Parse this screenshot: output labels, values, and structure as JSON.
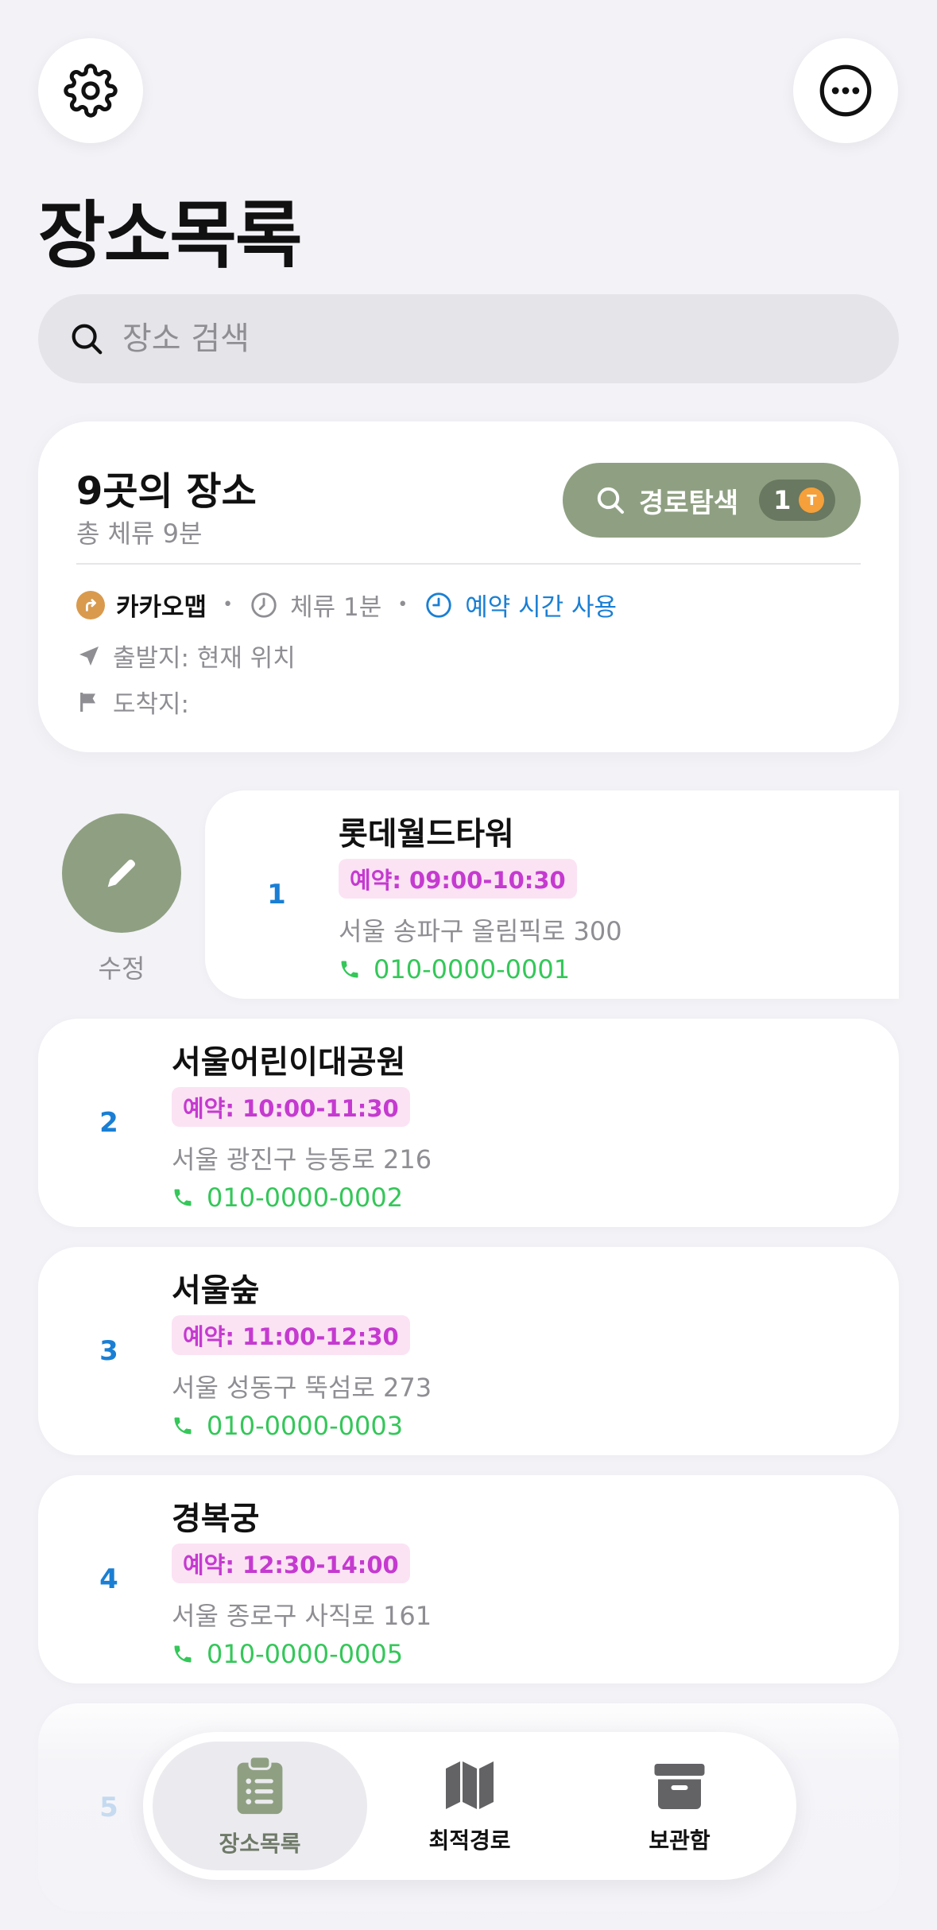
{
  "header": {
    "settings_icon": "gear-icon",
    "more_icon": "ellipsis-circle-icon",
    "title": "장소목록"
  },
  "search": {
    "placeholder": "장소 검색",
    "value": ""
  },
  "summary": {
    "title": "9곳의 장소",
    "subtitle": "총 체류 9분",
    "route_button": {
      "label": "경로탐색",
      "count": "1",
      "badge_letter": "T"
    },
    "map_app": "카카오맵",
    "stay": "체류 1분",
    "reservation_toggle": "예약 시간 사용",
    "origin": "출발지: 현재 위치",
    "destination": "도착지:"
  },
  "edit_action": {
    "label": "수정"
  },
  "places": [
    {
      "num": "1",
      "name": "롯데월드타워",
      "reservation": "예약: 09:00-10:30",
      "address": "서울 송파구 올림픽로 300",
      "phone": "010-0000-0001"
    },
    {
      "num": "2",
      "name": "서울어린이대공원",
      "reservation": "예약: 10:00-11:30",
      "address": "서울 광진구 능동로 216",
      "phone": "010-0000-0002"
    },
    {
      "num": "3",
      "name": "서울숲",
      "reservation": "예약: 11:00-12:30",
      "address": "서울 성동구 뚝섬로 273",
      "phone": "010-0000-0003"
    },
    {
      "num": "4",
      "name": "경복궁",
      "reservation": "예약: 12:30-14:00",
      "address": "서울 종로구 사직로 161",
      "phone": "010-0000-0005"
    },
    {
      "num": "5",
      "name": "",
      "reservation": "",
      "address": "",
      "phone": ""
    }
  ],
  "tabbar": {
    "items": [
      {
        "label": "장소목록",
        "icon": "clipboard-list-icon",
        "active": true
      },
      {
        "label": "최적경로",
        "icon": "map-icon",
        "active": false
      },
      {
        "label": "보관함",
        "icon": "archive-box-icon",
        "active": false
      }
    ]
  },
  "colors": {
    "accent_green": "#8fa082",
    "link_blue": "#1a7fd4",
    "reservation_pink": "#c53ad0",
    "phone_green": "#34c759"
  }
}
